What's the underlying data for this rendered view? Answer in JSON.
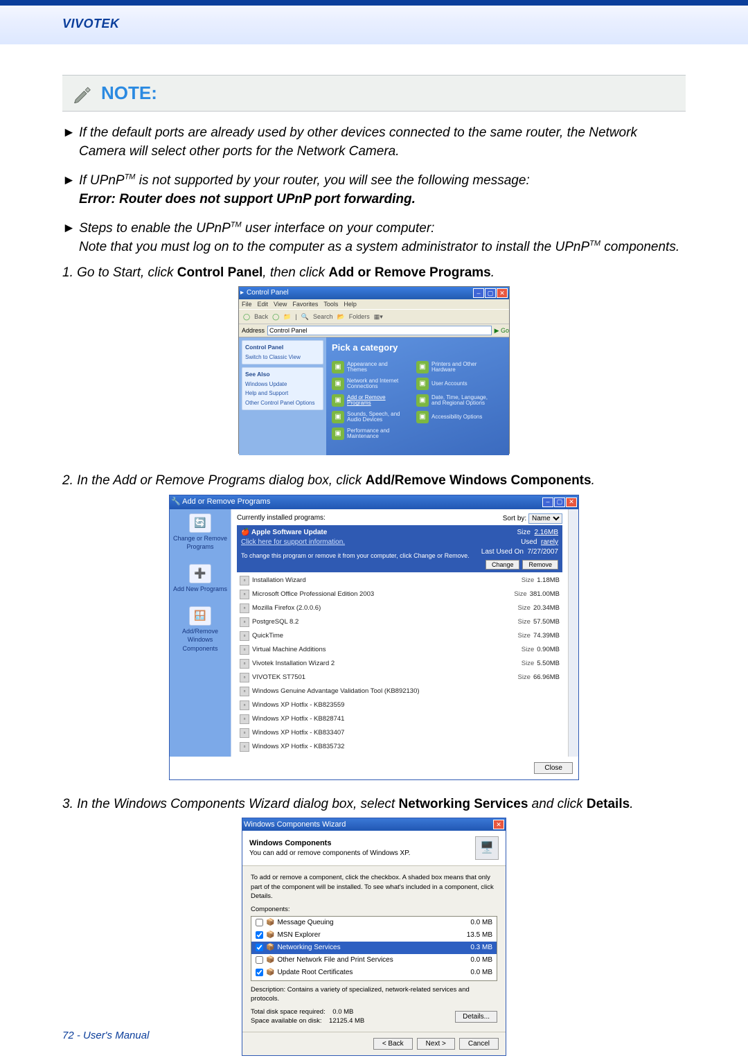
{
  "brand": "VIVOTEK",
  "note_label": "NOTE:",
  "bullets": [
    {
      "arrow": "►",
      "text": "If the default ports are already used by other devices connected to the same router, the Network Camera will select other ports for the Network Camera."
    },
    {
      "arrow": "►",
      "pre": "If UPnP",
      "tm": "TM",
      "post": " is not supported by your router, you will see the following message:",
      "bold": "Error: Router does not support UPnP port forwarding."
    },
    {
      "arrow": "►",
      "pre": "Steps to enable the UPnP",
      "tm": "TM",
      "post": " user interface on your computer:",
      "note_pre": "Note that you must log on to the computer as a system administrator to install the UPnP",
      "tm2": "TM",
      "note_post": " components."
    }
  ],
  "steps": {
    "s1_pre": "1. Go to Start, click ",
    "s1_b1": "Control Panel",
    "s1_mid": ", then click ",
    "s1_b2": "Add or Remove Programs",
    "s1_end": ".",
    "s2_pre": "2. In the Add or Remove Programs dialog box, click ",
    "s2_b": "Add/Remove Windows Components",
    "s2_end": ".",
    "s3_pre": "3. In the Windows Components Wizard dialog box, select ",
    "s3_b1": "Networking Services",
    "s3_mid": " and click ",
    "s3_b2": "Details",
    "s3_end": "."
  },
  "control_panel": {
    "title": "Control Panel",
    "menu": [
      "File",
      "Edit",
      "View",
      "Favorites",
      "Tools",
      "Help"
    ],
    "toolbar_back": "Back",
    "toolbar_search": "Search",
    "toolbar_folders": "Folders",
    "address_label": "Address",
    "address_value": "Control Panel",
    "go": "Go",
    "box1_title": "Control Panel",
    "box1_link": "Switch to Classic View",
    "box2_title": "See Also",
    "box2_links": [
      "Windows Update",
      "Help and Support",
      "Other Control Panel Options"
    ],
    "pick": "Pick a category",
    "cats": [
      {
        "label": "Appearance and Themes"
      },
      {
        "label": "Printers and Other Hardware"
      },
      {
        "label": "Network and Internet Connections"
      },
      {
        "label": "User Accounts"
      },
      {
        "label": "Add or Remove Programs",
        "hl": true
      },
      {
        "label": "Date, Time, Language, and Regional Options"
      },
      {
        "label": "Sounds, Speech, and Audio Devices"
      },
      {
        "label": "Accessibility Options"
      },
      {
        "label": "Performance and Maintenance"
      }
    ]
  },
  "arp": {
    "title": "Add or Remove Programs",
    "side": [
      {
        "label": "Change or Remove Programs"
      },
      {
        "label": "Add New Programs"
      },
      {
        "label": "Add/Remove Windows Components"
      }
    ],
    "list_label": "Currently installed programs:",
    "sort_label": "Sort by:",
    "sort_value": "Name",
    "selected": {
      "name": "Apple Software Update",
      "support": "Click here for support information.",
      "size_lbl": "Size",
      "size": "2.16MB",
      "used_lbl": "Used",
      "used": "rarely",
      "last_lbl": "Last Used On",
      "last": "7/27/2007",
      "note": "To change this program or remove it from your computer, click Change or Remove.",
      "btn_change": "Change",
      "btn_remove": "Remove"
    },
    "rows": [
      {
        "name": "Installation Wizard",
        "size": "1.18MB"
      },
      {
        "name": "Microsoft Office Professional Edition 2003",
        "size": "381.00MB"
      },
      {
        "name": "Mozilla Firefox (2.0.0.6)",
        "size": "20.34MB"
      },
      {
        "name": "PostgreSQL 8.2",
        "size": "57.50MB"
      },
      {
        "name": "QuickTime",
        "size": "74.39MB"
      },
      {
        "name": "Virtual Machine Additions",
        "size": "0.90MB"
      },
      {
        "name": "Vivotek Installation Wizard 2",
        "size": "5.50MB"
      },
      {
        "name": "VIVOTEK ST7501",
        "size": "66.96MB"
      },
      {
        "name": "Windows Genuine Advantage Validation Tool (KB892130)",
        "size": ""
      },
      {
        "name": "Windows XP Hotfix - KB823559",
        "size": ""
      },
      {
        "name": "Windows XP Hotfix - KB828741",
        "size": ""
      },
      {
        "name": "Windows XP Hotfix - KB833407",
        "size": ""
      },
      {
        "name": "Windows XP Hotfix - KB835732",
        "size": ""
      }
    ],
    "size_lbl": "Size",
    "close": "Close"
  },
  "wizard": {
    "title": "Windows Components Wizard",
    "head_b": "Windows Components",
    "head_s": "You can add or remove components of Windows XP.",
    "instr": "To add or remove a component, click the checkbox. A shaded box means that only part of the component will be installed. To see what's included in a component, click Details.",
    "comp_label": "Components:",
    "rows": [
      {
        "checked": false,
        "label": "Message Queuing",
        "size": "0.0 MB"
      },
      {
        "checked": true,
        "label": "MSN Explorer",
        "size": "13.5 MB"
      },
      {
        "checked": true,
        "label": "Networking Services",
        "size": "0.3 MB",
        "sel": true
      },
      {
        "checked": false,
        "label": "Other Network File and Print Services",
        "size": "0.0 MB"
      },
      {
        "checked": true,
        "label": "Update Root Certificates",
        "size": "0.0 MB"
      }
    ],
    "desc": "Description: Contains a variety of specialized, network-related services and protocols.",
    "space1_lbl": "Total disk space required:",
    "space1": "0.0 MB",
    "space2_lbl": "Space available on disk:",
    "space2": "12125.4 MB",
    "details": "Details...",
    "back": "< Back",
    "next": "Next >",
    "cancel": "Cancel"
  },
  "footer": "72 - User's Manual"
}
